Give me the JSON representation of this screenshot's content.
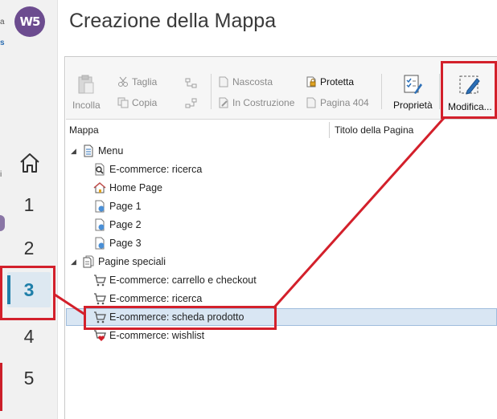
{
  "app": {
    "logo_text": "W5",
    "title": "Creazione della Mappa"
  },
  "sidebar": {
    "fragments": [
      "a",
      "s",
      "i"
    ],
    "steps": [
      "1",
      "2",
      "3",
      "4",
      "5"
    ],
    "active_step": "3"
  },
  "toolbar": {
    "paste": "Incolla",
    "cut": "Taglia",
    "copy": "Copia",
    "hidden": "Nascosta",
    "under_construction": "In Costruzione",
    "protected": "Protetta",
    "page404": "Pagina 404",
    "properties": "Proprietà",
    "edit": "Modifica..."
  },
  "columns": {
    "map": "Mappa",
    "page_title": "Titolo della Pagina"
  },
  "tree": {
    "menu_label": "Menu",
    "menu_items": [
      "E-commerce: ricerca",
      "Home Page",
      "Page 1",
      "Page 2",
      "Page 3"
    ],
    "special_label": "Pagine speciali",
    "special_items": [
      "E-commerce: carrello e checkout",
      "E-commerce: ricerca",
      "E-commerce: scheda prodotto",
      "E-commerce: wishlist"
    ],
    "selected": "E-commerce: scheda prodotto"
  },
  "colors": {
    "accent": "#1f7fa9",
    "annotation": "#d3202b",
    "logo": "#6c4c8f",
    "selection": "#d9e6f3"
  }
}
